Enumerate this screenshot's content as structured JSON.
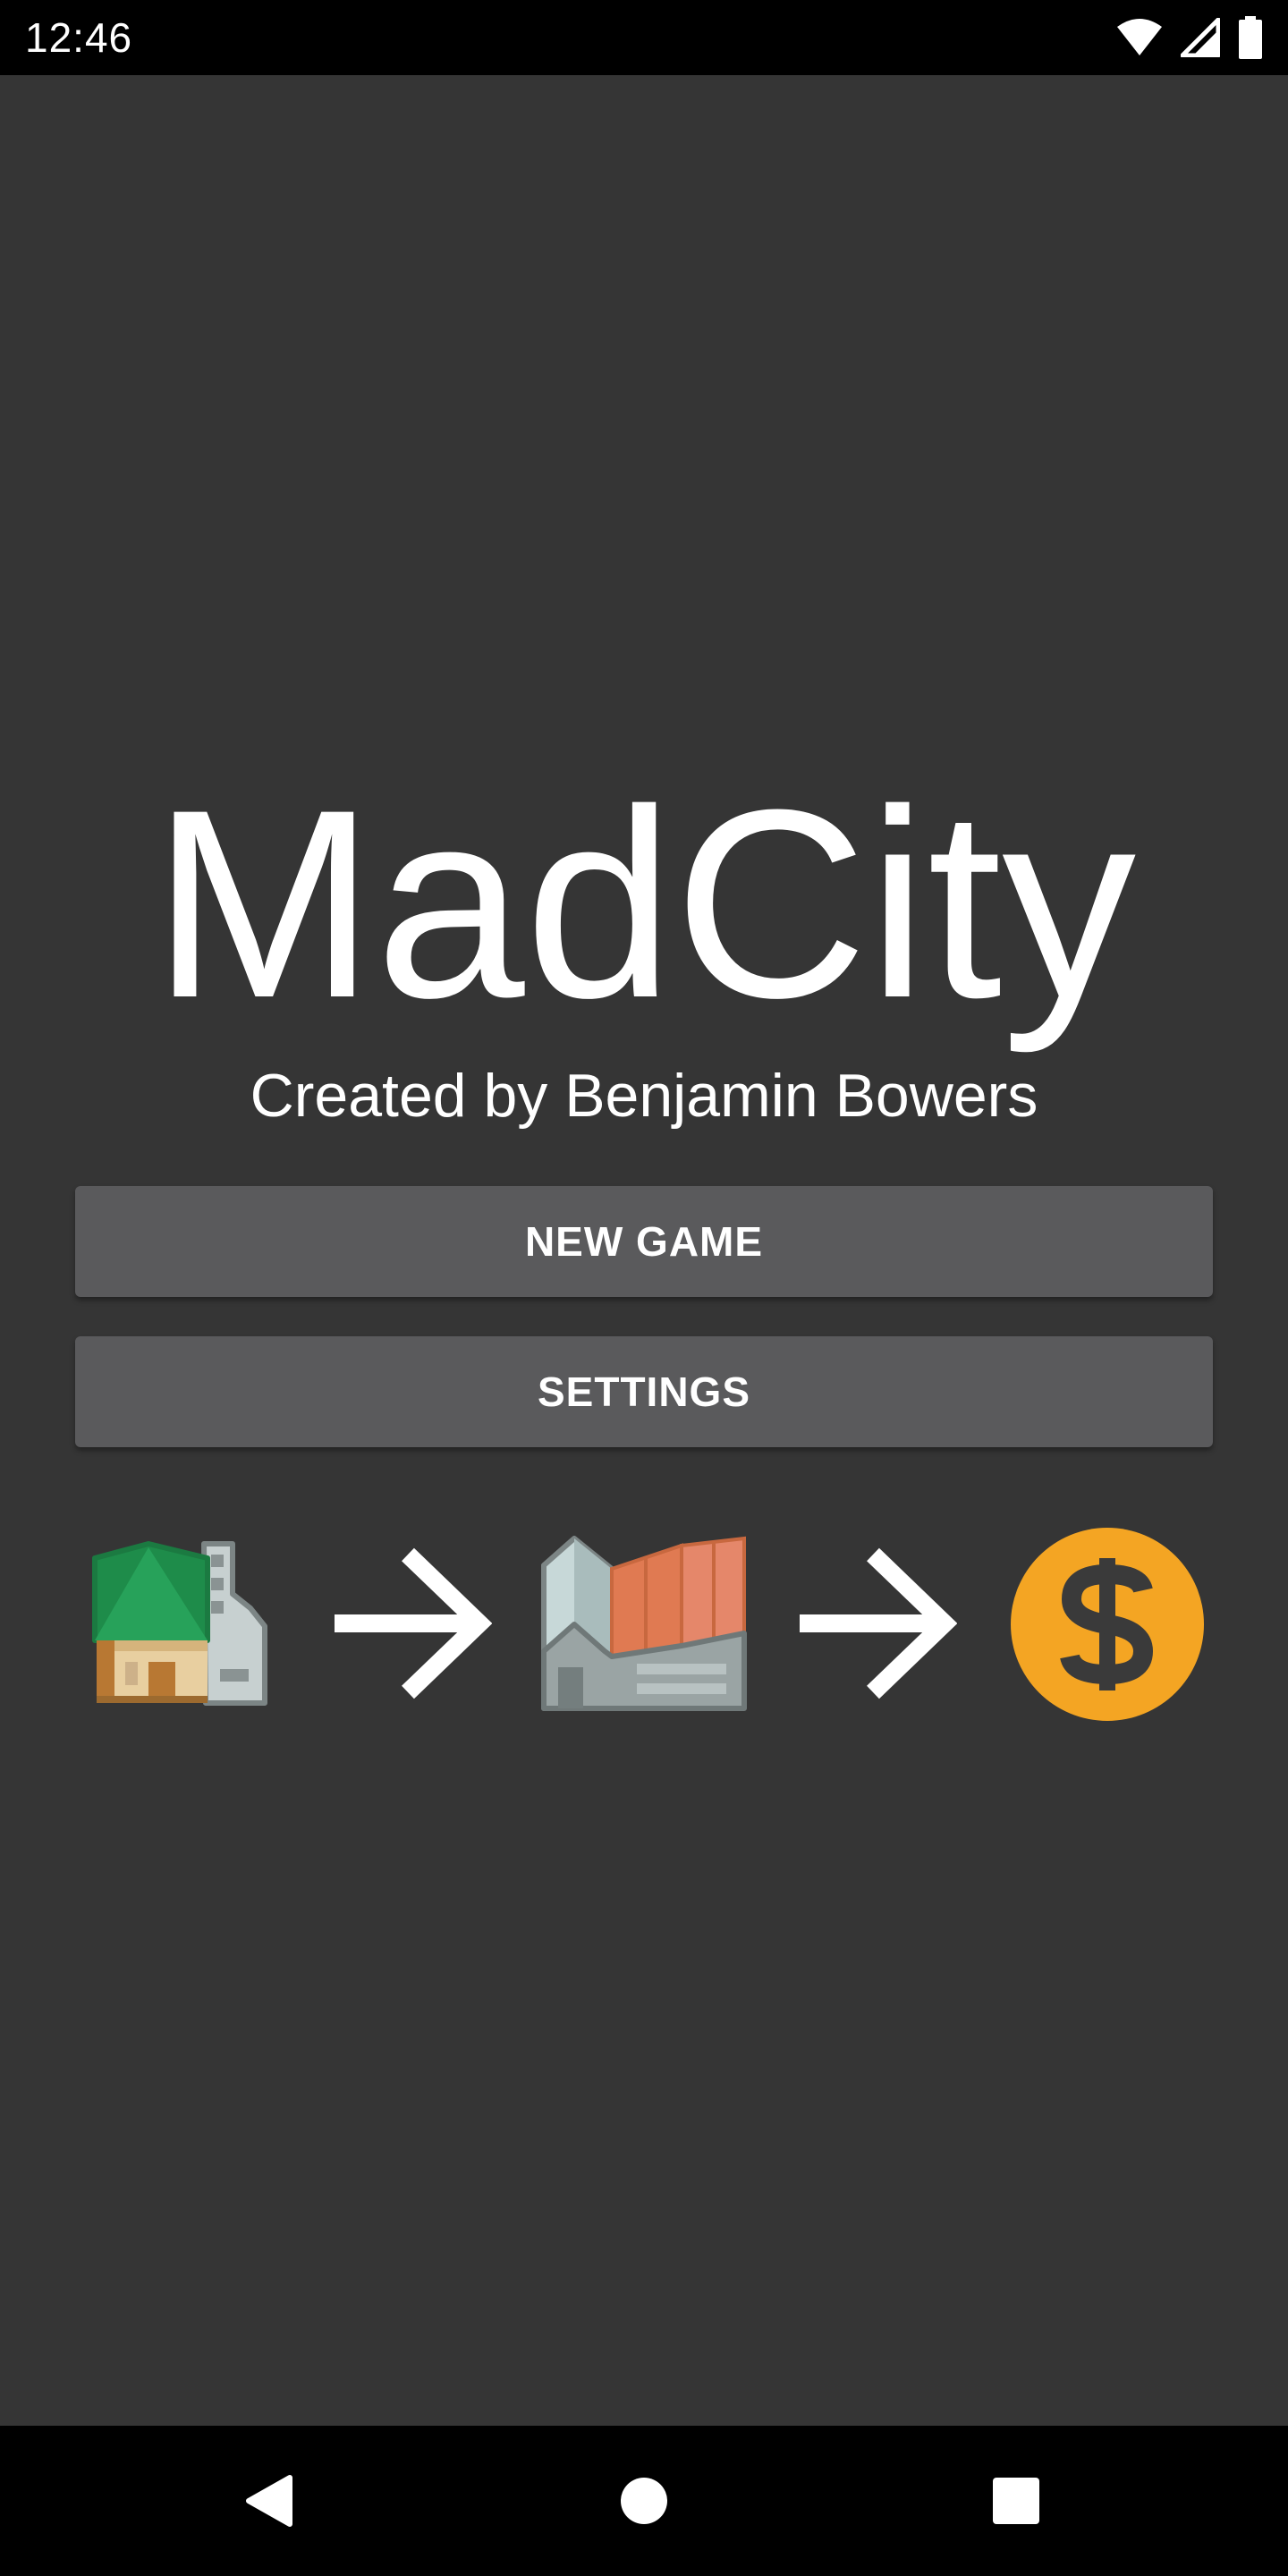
{
  "status_bar": {
    "time": "12:46",
    "icons": [
      "wifi-icon",
      "cellular-signal-icon",
      "battery-icon"
    ]
  },
  "app": {
    "title": "MadCity",
    "subtitle": "Created by Benjamin Bowers"
  },
  "menu": {
    "new_game_label": "NEW GAME",
    "settings_label": "SETTINGS"
  },
  "flow_icons": [
    "house-icon",
    "arrow-right-icon",
    "factory-icon",
    "arrow-right-icon",
    "dollar-coin-icon"
  ],
  "nav_bar": {
    "buttons": [
      "back-icon",
      "home-icon",
      "recents-icon"
    ]
  },
  "colors": {
    "background": "#353535",
    "button": "#5a5a5c",
    "coin": "#f4a523",
    "factory_accent": "#e07a52",
    "house_roof": "#1e8c4a"
  }
}
